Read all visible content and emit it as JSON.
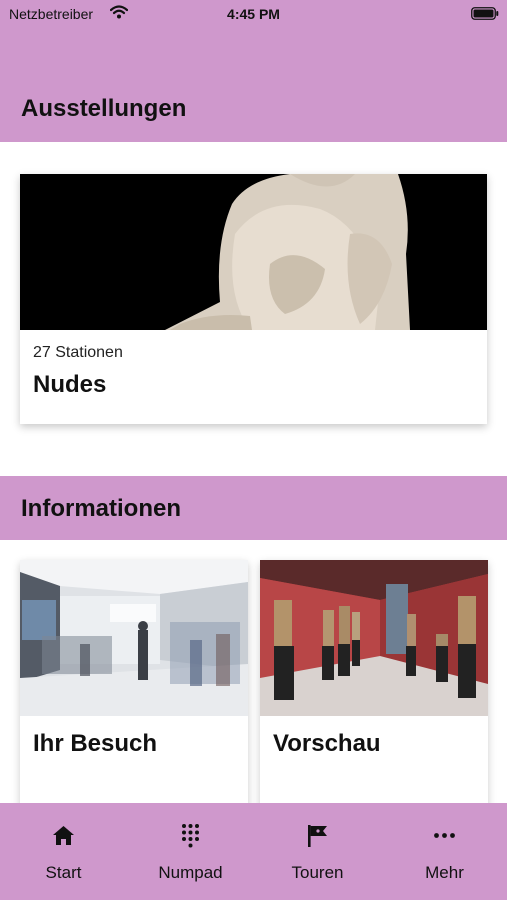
{
  "status_bar": {
    "carrier": "Netzbetreiber",
    "time": "4:45 PM",
    "icons": [
      "wifi-icon",
      "battery-icon"
    ]
  },
  "header": {
    "title": "Ausstellungen"
  },
  "exhibition": {
    "stations": "27 Stationen",
    "title": "Nudes"
  },
  "informationen": {
    "section_title": "Informationen",
    "cards": [
      {
        "title": "Ihr Besuch"
      },
      {
        "title": "Vorschau"
      }
    ]
  },
  "tabs": [
    {
      "label": "Start",
      "icon": "home-icon"
    },
    {
      "label": "Numpad",
      "icon": "numpad-icon"
    },
    {
      "label": "Touren",
      "icon": "flag-icon"
    },
    {
      "label": "Mehr",
      "icon": "more-icon"
    }
  ],
  "colors": {
    "accent": "#cf98cc",
    "background": "#ffffff",
    "text": "#111111"
  }
}
